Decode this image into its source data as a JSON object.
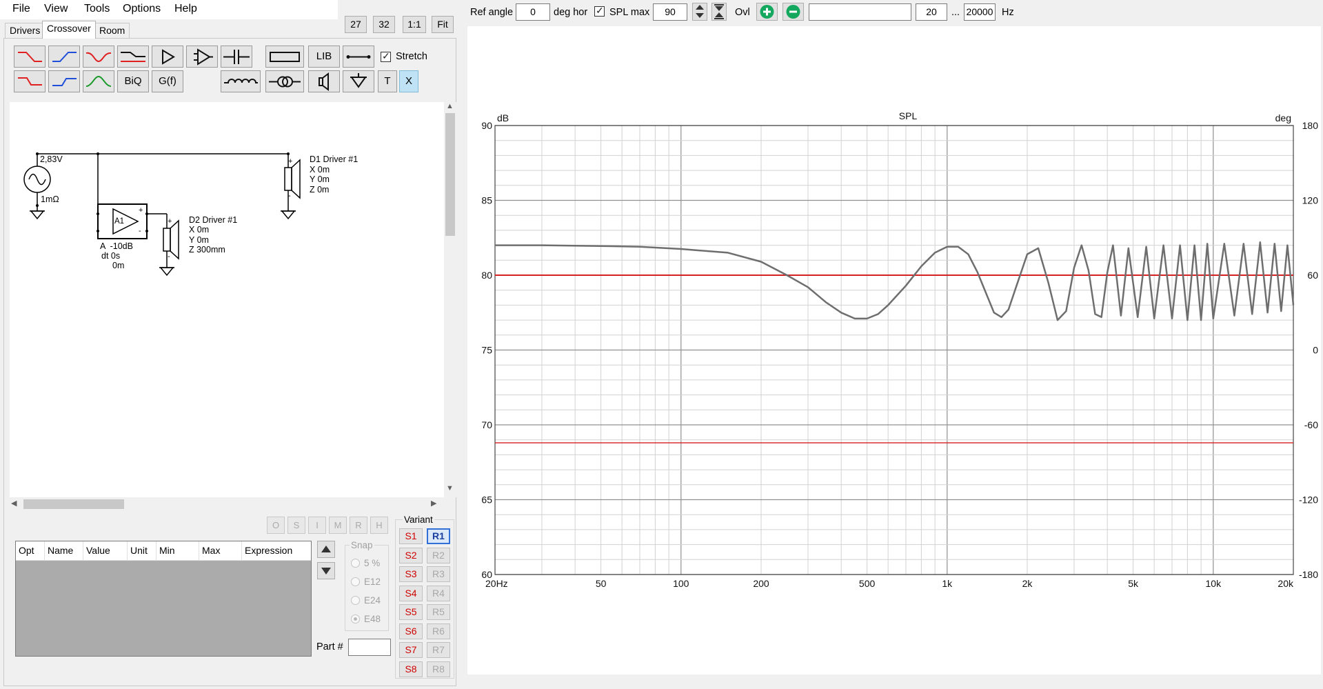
{
  "menu": [
    "File",
    "View",
    "Tools",
    "Options",
    "Help"
  ],
  "zoom_buttons": [
    "27",
    "32",
    "1:1",
    "Fit"
  ],
  "tabs": {
    "drivers": "Drivers",
    "crossover": "Crossover",
    "room": "Room"
  },
  "toolbar": {
    "lib": "LIB",
    "biq": "BiQ",
    "gf": "G(f)",
    "t": "T",
    "x": "X",
    "stretch": "Stretch",
    "stretch_checked": true
  },
  "schematic": {
    "source_voltage": "2,83V",
    "source_resistance": "1mΩ",
    "amp_label": "A1",
    "amp_gain": "A  -10dB",
    "amp_delay": "dt 0s",
    "amp_dist": "0m",
    "d1": {
      "name": "D1 Driver #1",
      "x": "X 0m",
      "y": "Y 0m",
      "z": "Z 0m"
    },
    "d2": {
      "name": "D2 Driver #1",
      "x": "X 0m",
      "y": "Y 0m",
      "z": "Z 300mm"
    }
  },
  "state_buttons": [
    "O",
    "S",
    "I",
    "M",
    "R",
    "H"
  ],
  "table": {
    "columns": [
      "Opt",
      "Name",
      "Value",
      "Unit",
      "Min",
      "Max",
      "Expression"
    ]
  },
  "snap": {
    "title": "Snap",
    "options": [
      "5 %",
      "E12",
      "E24",
      "E48"
    ],
    "selected": "E48"
  },
  "part_label": "Part #",
  "variant": {
    "title": "Variant",
    "s": [
      "S1",
      "S2",
      "S3",
      "S4",
      "S5",
      "S6",
      "S7",
      "S8"
    ],
    "r": [
      "R1",
      "R2",
      "R3",
      "R4",
      "R5",
      "R6",
      "R7",
      "R8"
    ],
    "active": "R1"
  },
  "topbar": {
    "ref_angle_label": "Ref angle",
    "ref_angle_value": "0",
    "deg_hor": "deg hor",
    "spl_max_label": "SPL max",
    "spl_max_checked": true,
    "spl_max_value": "90",
    "ovl": "Ovl",
    "freq_min": "20",
    "ellipsis": "...",
    "freq_max": "20000",
    "hz": "Hz"
  },
  "colors": {
    "trace": "#6e6e6e",
    "ref_line": "#d42020",
    "grid": "#d2d2d2",
    "major_grid": "#909090",
    "filter_red": "#e02020",
    "filter_blue": "#1f4fd8",
    "filter_green": "#1a9a2a"
  },
  "chart_data": {
    "type": "line",
    "title": "SPL",
    "xlabel": "",
    "ylabel": "dB",
    "y2label": "deg",
    "xscale": "log",
    "xlim": [
      20,
      20000
    ],
    "ylim": [
      60,
      90
    ],
    "y2lim": [
      -180,
      180
    ],
    "xticks": [
      20,
      50,
      100,
      200,
      500,
      1000,
      2000,
      5000,
      10000,
      20000
    ],
    "xtick_labels": [
      "20Hz",
      "50",
      "100",
      "200",
      "500",
      "1k",
      "2k",
      "5k",
      "10k",
      "20k"
    ],
    "yticks": [
      60,
      65,
      70,
      75,
      80,
      85,
      90
    ],
    "y2ticks": [
      -180,
      -120,
      -60,
      0,
      60,
      120,
      180
    ],
    "reference_lines": [
      80,
      68.8
    ],
    "series": [
      {
        "x": [
          20,
          30,
          50,
          70,
          100,
          150,
          200,
          250,
          300,
          350,
          400,
          450,
          500,
          550,
          600,
          700,
          800,
          900,
          1000,
          1100,
          1200,
          1300,
          1400,
          1500,
          1600,
          1700,
          1800,
          2000,
          2200,
          2400,
          2600,
          2800,
          3000,
          3200,
          3400,
          3600,
          3800,
          4000,
          4200,
          4500,
          4800,
          5200,
          5600,
          6000,
          6500,
          7000,
          7500,
          8000,
          8500,
          9000,
          9500,
          10000,
          11000,
          12000,
          13000,
          14000,
          15000,
          16000,
          17000,
          18000,
          19000,
          20000
        ],
        "y": [
          82.0,
          82.0,
          81.95,
          81.9,
          81.75,
          81.5,
          80.9,
          80.0,
          79.2,
          78.2,
          77.5,
          77.1,
          77.1,
          77.4,
          78.0,
          79.3,
          80.6,
          81.5,
          81.9,
          81.9,
          81.4,
          80.2,
          78.8,
          77.5,
          77.2,
          77.7,
          79.0,
          81.4,
          81.8,
          79.5,
          77.0,
          77.6,
          80.5,
          82.0,
          80.3,
          77.4,
          77.2,
          80.2,
          82.0,
          77.3,
          81.8,
          77.2,
          81.9,
          77.1,
          82.0,
          77.1,
          82.0,
          77.0,
          82.0,
          77.0,
          82.1,
          77.1,
          82.1,
          77.3,
          82.1,
          77.4,
          82.2,
          77.5,
          82.1,
          77.6,
          82.0,
          78.0
        ]
      }
    ]
  }
}
